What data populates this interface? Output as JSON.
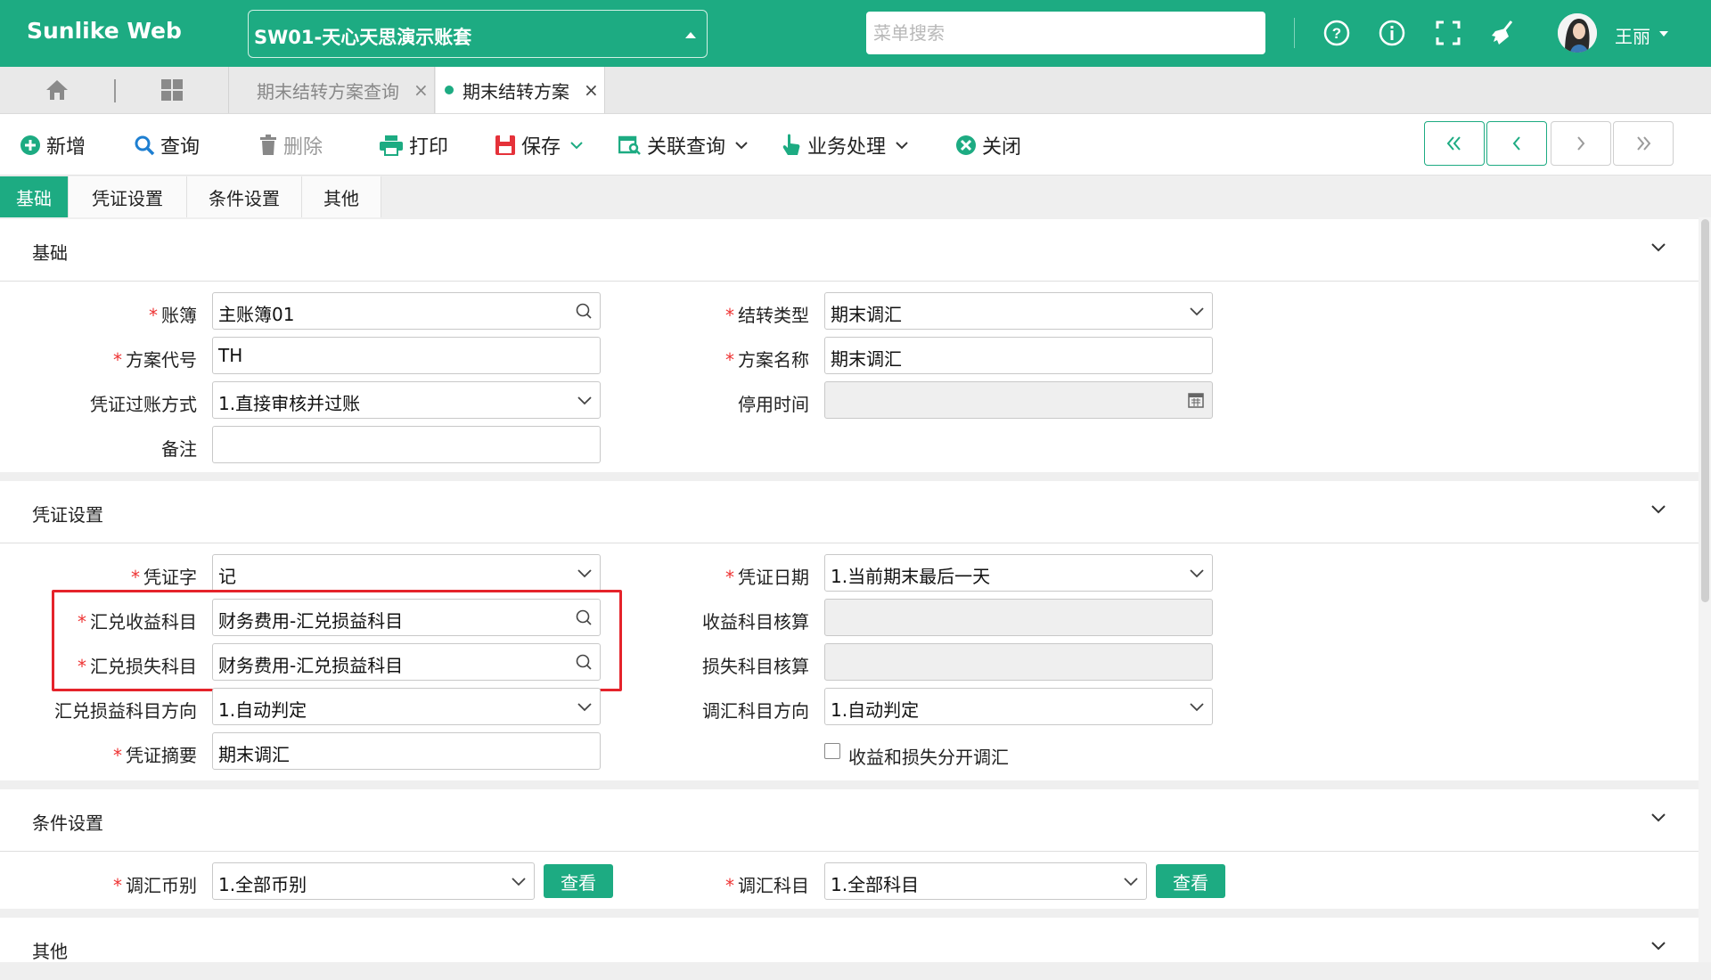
{
  "app": {
    "brand": "Sunlike Web",
    "account": "SW01-天心天思演示账套",
    "search_placeholder": "菜单搜索",
    "user": "王丽"
  },
  "tabs": [
    {
      "label": "期末结转方案查询",
      "close": "×"
    },
    {
      "label": "期末结转方案",
      "close": "×"
    }
  ],
  "toolbar": {
    "add": "新增",
    "query": "查询",
    "delete": "删除",
    "print": "打印",
    "save": "保存",
    "related": "关联查询",
    "business": "业务处理",
    "close": "关闭"
  },
  "form_tabs": [
    "基础",
    "凭证设置",
    "条件设置",
    "其他"
  ],
  "sections": {
    "basic": {
      "title": "基础",
      "book_label": "账簿",
      "book_value": "主账簿01",
      "transfer_type_label": "结转类型",
      "transfer_type_value": "期末调汇",
      "code_label": "方案代号",
      "code_value": "TH",
      "name_label": "方案名称",
      "name_value": "期末调汇",
      "posting_label": "凭证过账方式",
      "posting_value": "1.直接审核并过账",
      "disable_time_label": "停用时间",
      "disable_time_value": "",
      "remark_label": "备注",
      "remark_value": ""
    },
    "voucher": {
      "title": "凭证设置",
      "word_label": "凭证字",
      "word_value": "记",
      "date_label": "凭证日期",
      "date_value": "1.当前期末最后一天",
      "gain_label": "汇兑收益科目",
      "gain_value": "财务费用-汇兑损益科目",
      "gain_acc_label": "收益科目核算",
      "gain_acc_value": "",
      "loss_label": "汇兑损失科目",
      "loss_value": "财务费用-汇兑损益科目",
      "loss_acc_label": "损失科目核算",
      "loss_acc_value": "",
      "direction_label": "汇兑损益科目方向",
      "direction_value": "1.自动判定",
      "adj_direction_label": "调汇科目方向",
      "adj_direction_value": "1.自动判定",
      "summary_label": "凭证摘要",
      "summary_value": "期末调汇",
      "separate_label": "收益和损失分开调汇",
      "separate_checked": false
    },
    "condition": {
      "title": "条件设置",
      "currency_label": "调汇币别",
      "currency_value": "1.全部币别",
      "account_label": "调汇科目",
      "account_value": "1.全部科目",
      "view_label": "查看"
    },
    "other": {
      "title": "其他"
    }
  },
  "required_mark": "*"
}
